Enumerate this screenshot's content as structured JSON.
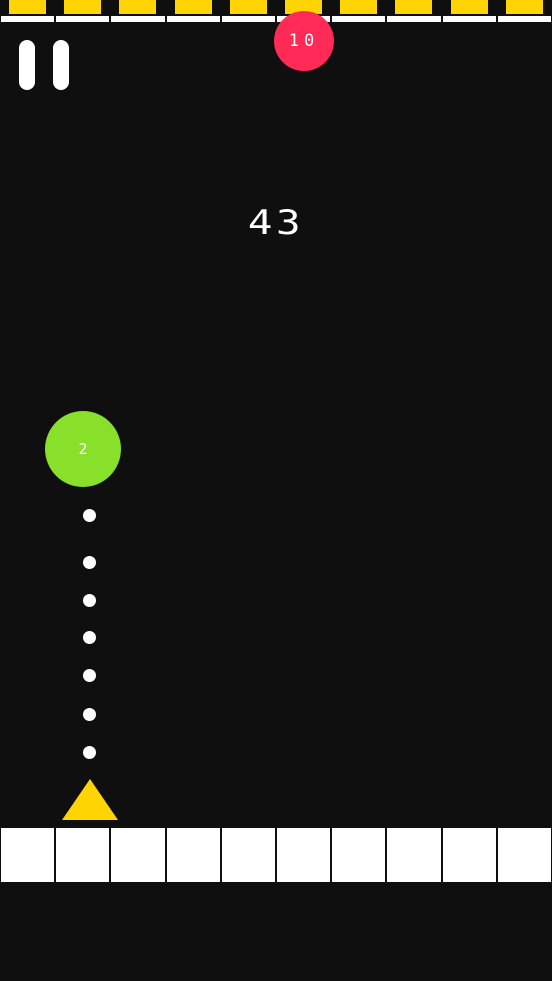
{
  "game": {
    "score": "43",
    "top_ball_value": "10",
    "active_ball_value": "2",
    "colors": {
      "background": "#0f0f0f",
      "top_block": "#ffd400",
      "bar": "#ffffff",
      "red_ball": "#ff2a55",
      "green_ball": "#88e02b",
      "shooter": "#ffd400"
    }
  },
  "controls": {
    "pause_icon": "pause-icon"
  }
}
